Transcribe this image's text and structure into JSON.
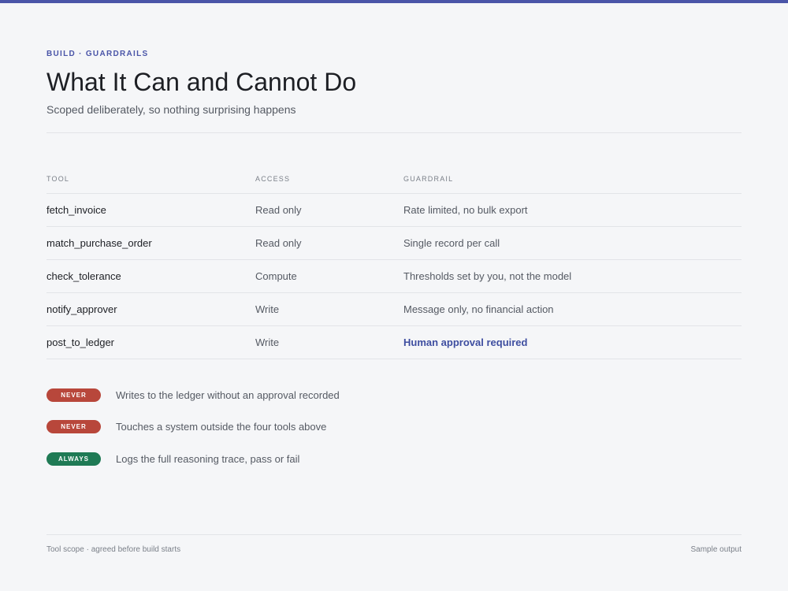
{
  "header": {
    "eyebrow": "BUILD · GUARDRAILS",
    "title": "What It Can and Cannot Do",
    "subtitle": "Scoped deliberately, so nothing surprising happens"
  },
  "table": {
    "columns": [
      "TOOL",
      "ACCESS",
      "GUARDRAIL"
    ],
    "rows": [
      {
        "tool": "fetch_invoice",
        "access": "Read only",
        "guardrail": "Rate limited, no bulk export"
      },
      {
        "tool": "match_purchase_order",
        "access": "Read only",
        "guardrail": "Single record per call"
      },
      {
        "tool": "check_tolerance",
        "access": "Compute",
        "guardrail": "Thresholds set by you, not the model"
      },
      {
        "tool": "notify_approver",
        "access": "Write",
        "guardrail": "Message only, no financial action"
      },
      {
        "tool": "post_to_ledger",
        "access": "Write",
        "guardrail": "Human approval required"
      }
    ]
  },
  "rules": [
    {
      "badge": "NEVER",
      "text": "Writes to the ledger without an approval recorded"
    },
    {
      "badge": "NEVER",
      "text": "Touches a system outside the four tools above"
    },
    {
      "badge": "ALWAYS",
      "text": "Logs the full reasoning trace, pass or fail"
    }
  ],
  "footer": {
    "left": "Tool scope · agreed before build starts",
    "right": "Sample output"
  },
  "colors": {
    "accent": "#4a55a8",
    "never": "#b8473b",
    "always": "#1f7a55",
    "highlight_text": "#3e4ea0"
  }
}
